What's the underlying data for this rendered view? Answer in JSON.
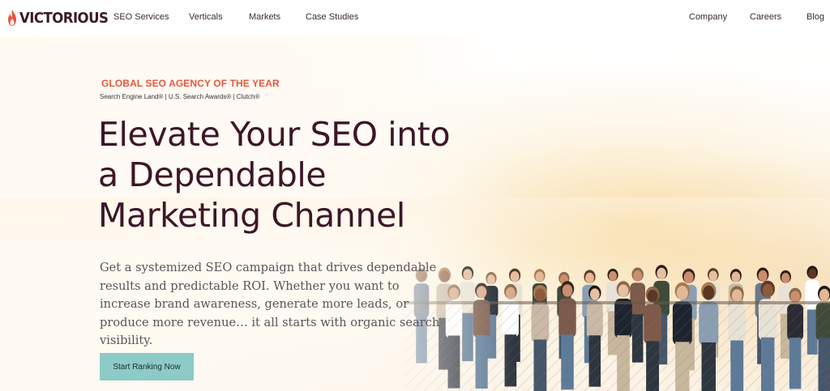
{
  "brand": {
    "name": "VICTORIOUS",
    "accent": "#e8553c",
    "dark": "#3d1628",
    "cta_color": "#8ccbc8"
  },
  "nav": {
    "left": [
      "SEO Services",
      "Verticals",
      "Markets",
      "Case Studies"
    ],
    "right": [
      "Company",
      "Careers",
      "Blog"
    ]
  },
  "hero": {
    "eyebrow": "GLOBAL SEO AGENCY OF THE YEAR",
    "awards": "Search Engine Land® | U.S. Search Awards® | Clutch®",
    "headline": [
      "Elevate Your SEO into",
      "a Dependable",
      "Marketing Channel"
    ],
    "subcopy": "Get a systemized SEO campaign that drives dependable results and predictable ROI. Whether you want to increase brand awareness, generate more leads, or produce more revenue… it all starts with organic search visibility.",
    "cta_label": "Start Ranking Now",
    "photo_icon": "team-group-photo"
  }
}
